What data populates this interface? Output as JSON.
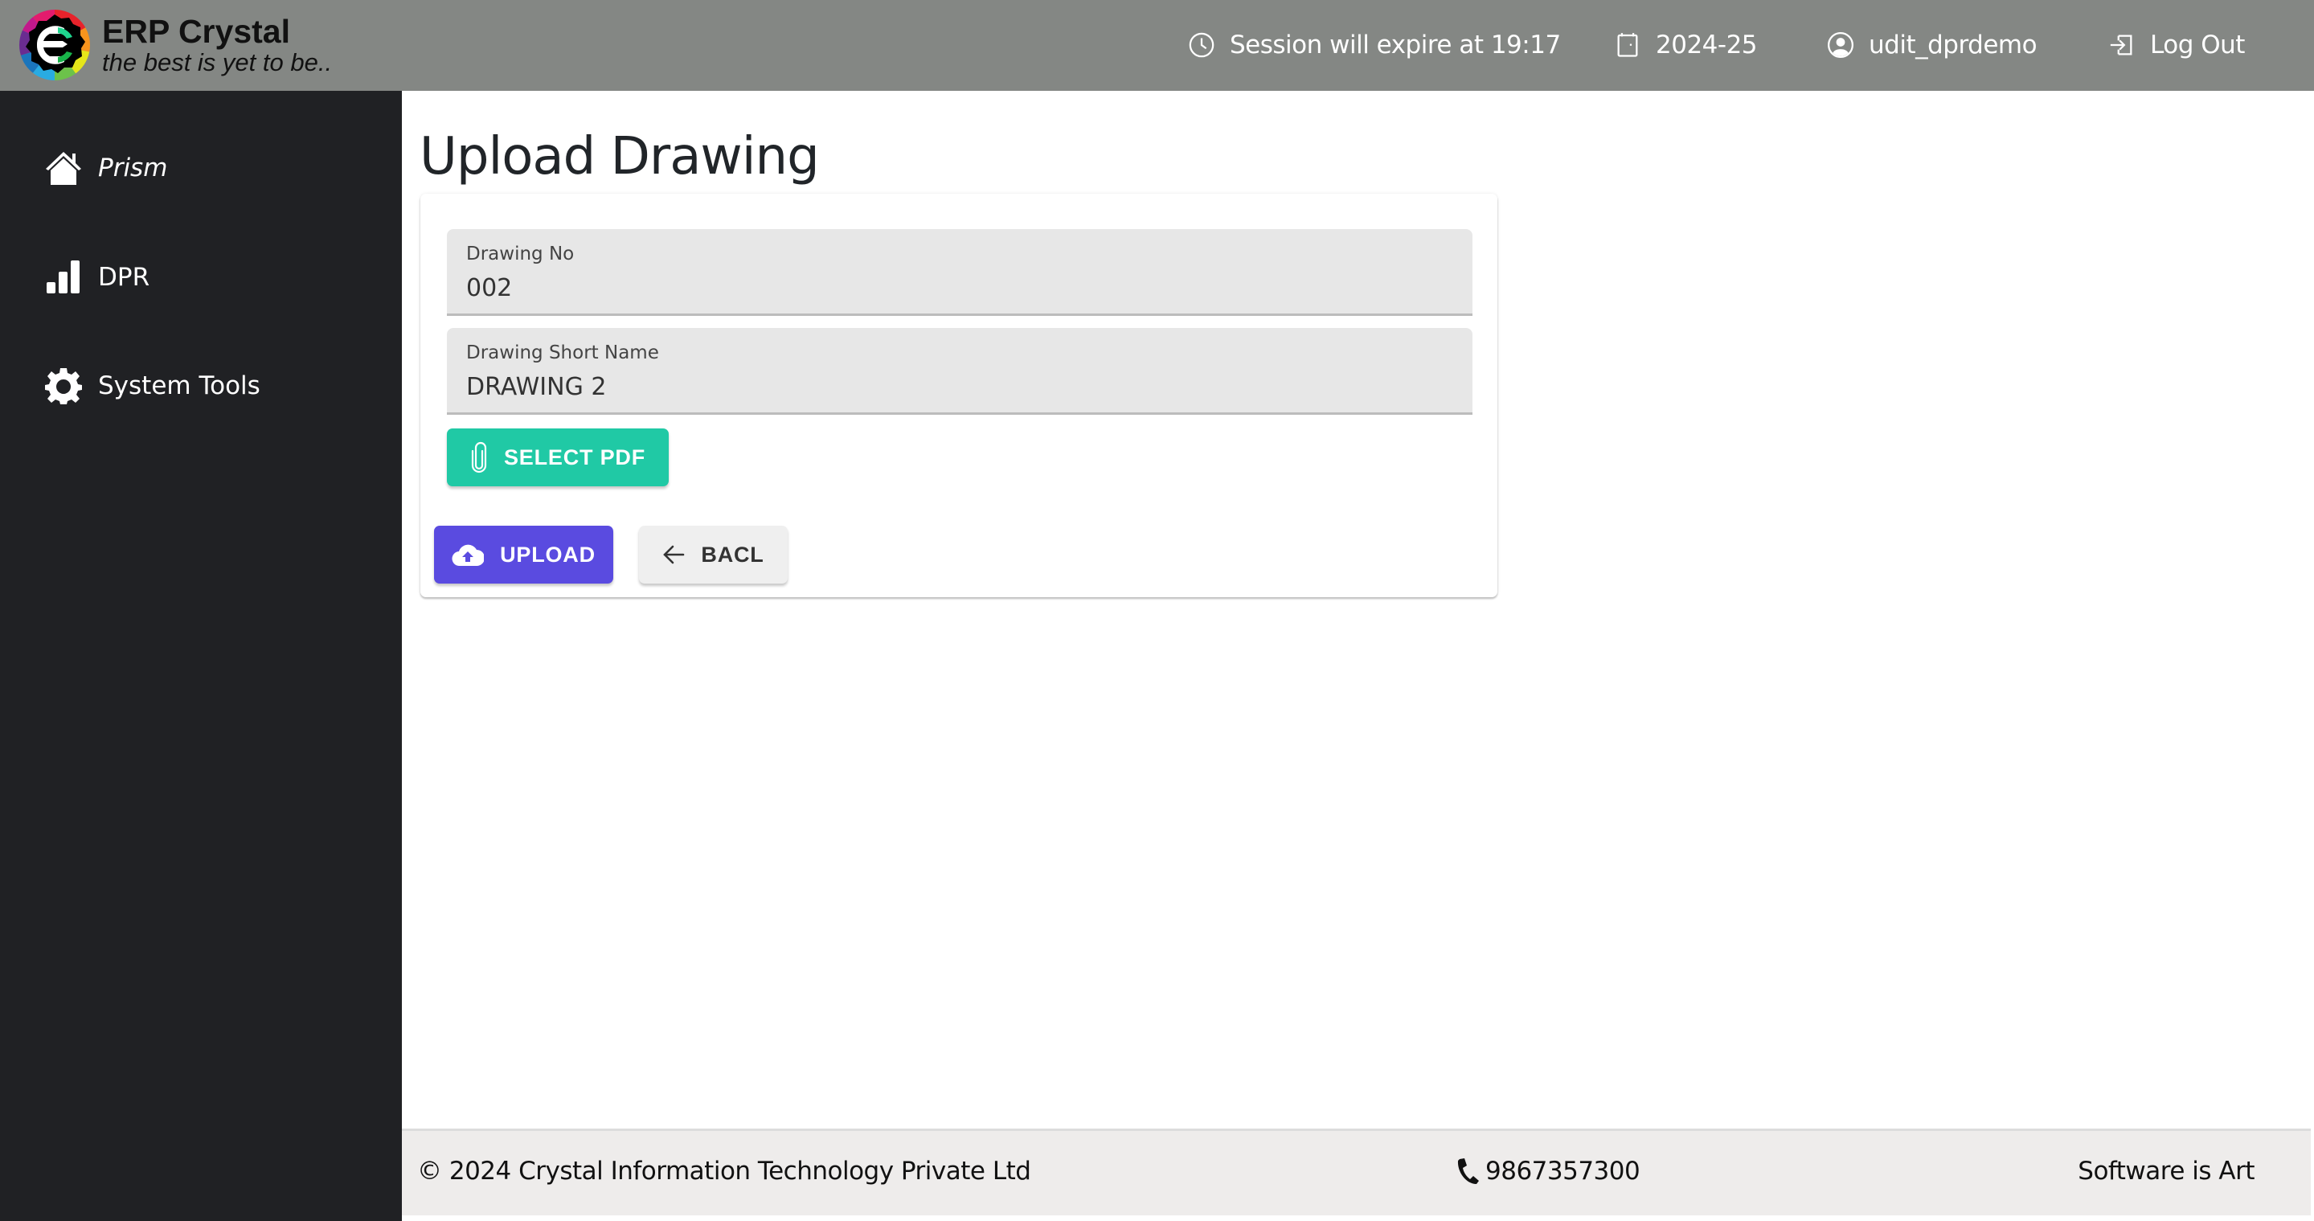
{
  "header": {
    "brand_title": "ERP Crystal",
    "brand_tagline": "the best is yet to be..",
    "session_text": "Session will expire at 19:17",
    "financial_year": "2024-25",
    "username": "udit_dprdemo",
    "logout_label": "Log Out",
    "icons": {
      "session": "clock-icon",
      "year": "calendar-icon",
      "user": "user-circle-icon",
      "logout": "logout-icon"
    }
  },
  "sidebar": {
    "items": [
      {
        "label": "Prism",
        "icon": "home-icon"
      },
      {
        "label": "DPR",
        "icon": "bar-chart-icon"
      },
      {
        "label": "System Tools",
        "icon": "gear-icon"
      }
    ]
  },
  "main": {
    "title": "Upload Drawing",
    "form": {
      "drawing_no": {
        "label": "Drawing No",
        "value": "002"
      },
      "drawing_short_name": {
        "label": "Drawing Short Name",
        "value": "DRAWING 2"
      },
      "select_pdf_label": "SELECT PDF",
      "upload_label": "UPLOAD",
      "back_label": "BACL"
    }
  },
  "footer": {
    "copyright": "© 2024 Crystal Information Technology Private Ltd",
    "phone": "9867357300",
    "tagline": "Software is Art"
  },
  "colors": {
    "header_bg": "#848784",
    "sidebar_bg": "#202124",
    "select_pdf_button": "#20c9a5",
    "upload_button": "#5a4be0",
    "back_button": "#efefef",
    "footer_bg": "#eeeceb"
  }
}
